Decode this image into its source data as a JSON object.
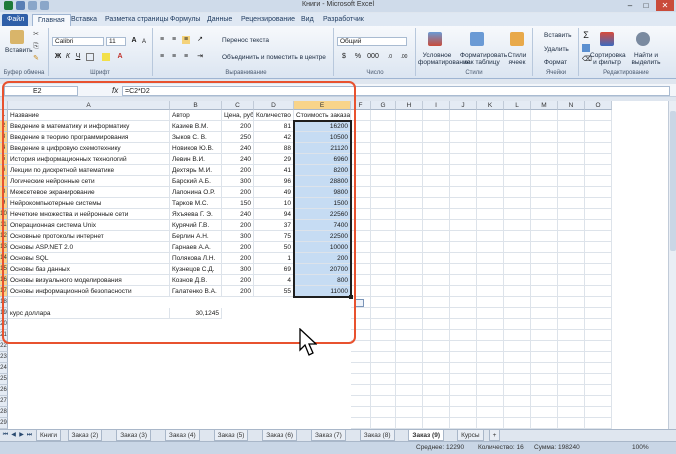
{
  "window": {
    "title": "Книги - Microsoft Excel",
    "controls": {
      "minimize": "–",
      "maximize": "□",
      "close": "✕"
    }
  },
  "ribbon": {
    "tabs": [
      {
        "label": "Файл"
      },
      {
        "label": "Главная"
      },
      {
        "label": "Вставка"
      },
      {
        "label": "Разметка страницы"
      },
      {
        "label": "Формулы"
      },
      {
        "label": "Данные"
      },
      {
        "label": "Рецензирование"
      },
      {
        "label": "Вид"
      },
      {
        "label": "Разработчик"
      }
    ],
    "active_tab": "Главная",
    "groups": {
      "clipboard": {
        "label": "Буфер обмена",
        "paste": "Вставить"
      },
      "font": {
        "label": "Шрифт",
        "font_name": "Calibri",
        "font_size": "11",
        "bold": "Ж",
        "italic": "К",
        "underline": "Ч"
      },
      "alignment": {
        "label": "Выравнивание",
        "wrap": "Перенос текста",
        "merge": "Объединить и поместить в центре"
      },
      "number": {
        "label": "Число",
        "format": "Общий",
        "percent": "%",
        "thousands": "000"
      },
      "styles": {
        "label": "Стили",
        "conditional": "Условное форматирование",
        "as_table": "Форматировать как таблицу",
        "cell_styles": "Стили ячеек"
      },
      "cells": {
        "label": "Ячейки",
        "insert": "Вставить",
        "delete": "Удалить",
        "format": "Формат"
      },
      "editing": {
        "label": "Редактирование",
        "sort": "Сортировка и фильтр",
        "find": "Найти и выделить",
        "sum": "Σ"
      }
    }
  },
  "formula_bar": {
    "name_box": "E2",
    "fx": "fx",
    "formula": "=C2*D2"
  },
  "grid": {
    "columns": [
      "A",
      "B",
      "C",
      "D",
      "E",
      "F",
      "G",
      "H",
      "I",
      "J",
      "K",
      "L",
      "M",
      "N",
      "O"
    ],
    "selected_column": "E",
    "row_numbers": [
      "1",
      "2",
      "3",
      "4",
      "5",
      "6",
      "7",
      "8",
      "9",
      "10",
      "11",
      "12",
      "13",
      "14",
      "15",
      "16",
      "17",
      "18",
      "19",
      "20",
      "21",
      "22",
      "23",
      "24",
      "25",
      "26",
      "27",
      "28",
      "29",
      "30"
    ],
    "header_row": [
      "Название",
      "Автор",
      "Цена, руб.",
      "Количество",
      "Стоимость заказа"
    ],
    "rows": [
      [
        "Введение в математику и информатику",
        "Казиев В.М.",
        "200",
        "81",
        "16200"
      ],
      [
        "Введение в теорию программирования",
        "Зыков С. В.",
        "250",
        "42",
        "10500"
      ],
      [
        "Введение в цифровую схемотехнику",
        "Новиков Ю.В.",
        "240",
        "88",
        "21120"
      ],
      [
        "История информационных технологий",
        "Левин В.И.",
        "240",
        "29",
        "6960"
      ],
      [
        "Лекции по дискретной математике",
        "Дехтярь М.И.",
        "200",
        "41",
        "8200"
      ],
      [
        "Логические нейронные сети",
        "Барский А.Б.",
        "300",
        "96",
        "28800"
      ],
      [
        "Межсетевое экранирование",
        "Лапонина О.Р.",
        "200",
        "49",
        "9800"
      ],
      [
        "Нейрокомпьютерные системы",
        "Тарков М.С.",
        "150",
        "10",
        "1500"
      ],
      [
        "Нечеткие множества и нейронные сети",
        "Яхъяева Г. Э.",
        "240",
        "94",
        "22560"
      ],
      [
        "Операционная система Unix",
        "Курячий Г.В.",
        "200",
        "37",
        "7400"
      ],
      [
        "Основные протоколы интернет",
        "Берлин А.Н.",
        "300",
        "75",
        "22500"
      ],
      [
        "Основы ASP.NET 2.0",
        "Гарнаев А.А.",
        "200",
        "50",
        "10000"
      ],
      [
        "Основы SQL",
        "Полякова Л.Н.",
        "200",
        "1",
        "200"
      ],
      [
        "Основы баз данных",
        "Кузнецов С.Д.",
        "300",
        "69",
        "20700"
      ],
      [
        "Основы визуального моделирования",
        "Кознов Д.В.",
        "200",
        "4",
        "800"
      ],
      [
        "Основы информационной безопасности",
        "Галатенко В.А.",
        "200",
        "55",
        "11000"
      ]
    ],
    "extra": {
      "label": "курс доллара",
      "value": "30,1245"
    }
  },
  "sheets": {
    "tabs": [
      "Книги",
      "Заказ (2)",
      "Заказ (3)",
      "Заказ (4)",
      "Заказ (5)",
      "Заказ (6)",
      "Заказ (7)",
      "Заказ (8)",
      "Заказ (9)",
      "Курсы"
    ],
    "active": "Заказ (9)"
  },
  "status_bar": {
    "average": "Среднее: 12290",
    "count": "Количество: 16",
    "sum": "Сумма: 198240",
    "zoom": "100%"
  },
  "colors": {
    "selection": "#c6dcf3",
    "annotation": "#e8522f",
    "file_tab": "#2f5fa8"
  }
}
